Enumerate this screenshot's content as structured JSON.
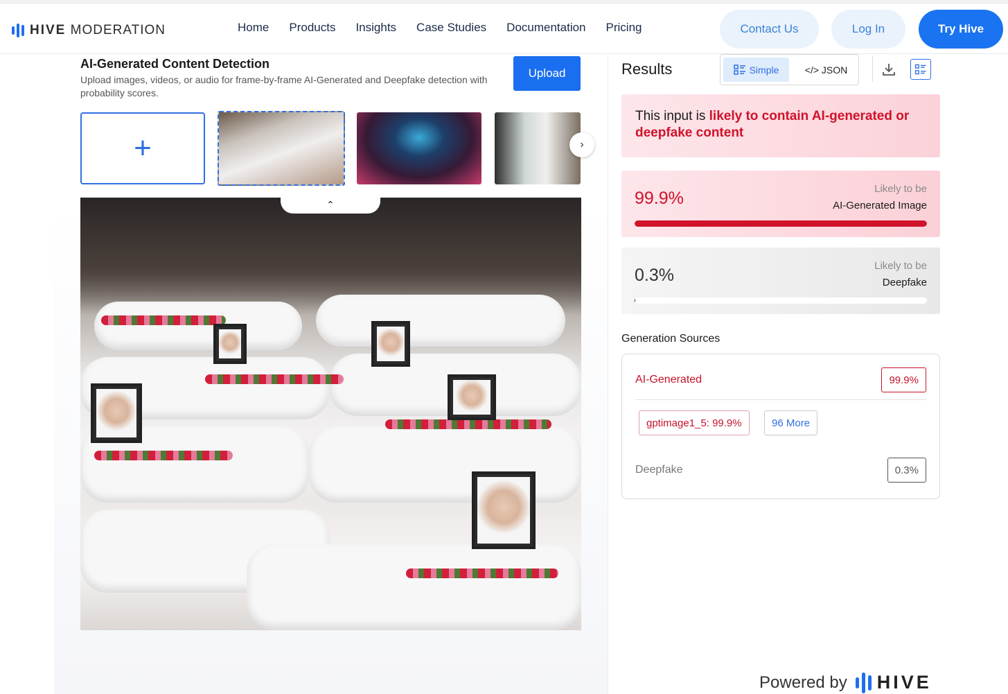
{
  "brand": {
    "name_bold": "HIVE",
    "name_rest": "MODERATION",
    "accent": "#1a73f0"
  },
  "nav": {
    "links": [
      "Home",
      "Products",
      "Insights",
      "Case Studies",
      "Documentation",
      "Pricing"
    ],
    "contact_label": "Contact Us",
    "login_label": "Log In",
    "try_label": "Try Hive"
  },
  "detector": {
    "title": "AI-Generated Content Detection",
    "description": "Upload images, videos, or audio for frame-by-frame AI-Generated and Deepfake detection with probability scores.",
    "upload_label": "Upload",
    "add_symbol": "+",
    "next_symbol": "›",
    "collapse_symbol": "⌃"
  },
  "results": {
    "title": "Results",
    "simple_label": "Simple",
    "json_label": "</> JSON",
    "verdict_prefix": "This input is ",
    "verdict_highlight": "likely to contain AI-generated or deepfake content",
    "scores": [
      {
        "pct_label": "99.9%",
        "value": 0.999,
        "likely": "Likely to be",
        "kind": "AI-Generated Image",
        "color": "#d0122a"
      },
      {
        "pct_label": "0.3%",
        "value": 0.003,
        "likely": "Likely to be",
        "kind": "Deepfake",
        "color": "#333333"
      }
    ],
    "generation": {
      "title": "Generation Sources",
      "ai_label": "AI-Generated",
      "ai_value": "99.9%",
      "model_tag": "gptimage1_5: 99.9%",
      "more_tag": "96 More",
      "deepfake_label": "Deepfake",
      "deepfake_value": "0.3%"
    }
  },
  "footer": {
    "powered_by": "Powered by",
    "logo_word": "HIVE"
  }
}
